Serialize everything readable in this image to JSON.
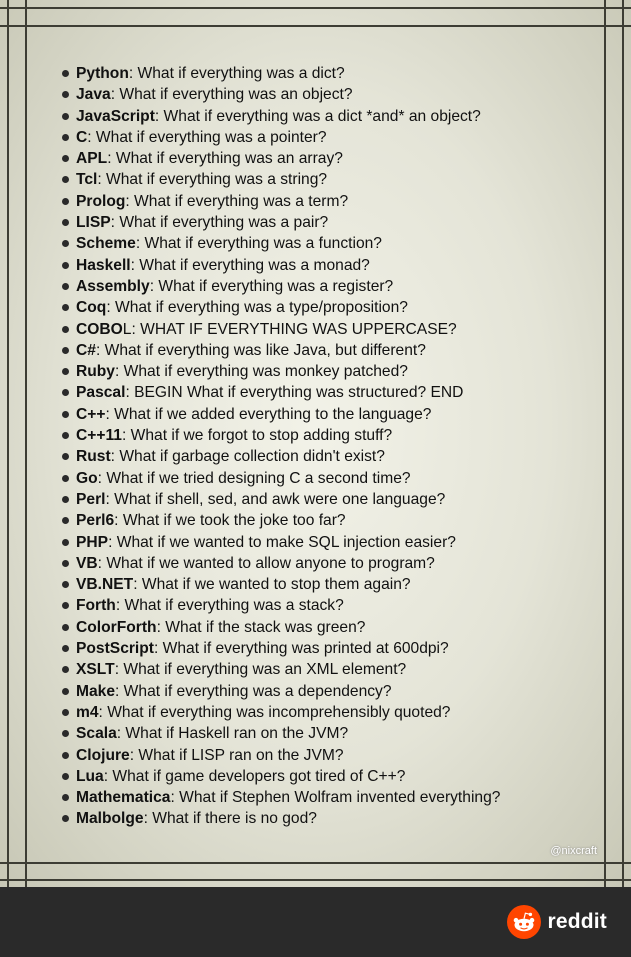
{
  "items": [
    {
      "lang": "Python",
      "text": ": What if everything was a dict?"
    },
    {
      "lang": "Java",
      "text": ": What if everything was an object?"
    },
    {
      "lang": "JavaScript",
      "text": ": What if everything was a dict *and* an object?"
    },
    {
      "lang": "C",
      "text": ": What if everything was a pointer?"
    },
    {
      "lang": "APL",
      "text": ": What if everything was an array?"
    },
    {
      "lang": "Tcl",
      "text": ": What if everything was a string?"
    },
    {
      "lang": "Prolog",
      "text": ": What if everything was a term?"
    },
    {
      "lang": "LISP",
      "text": ": What if everything was a pair?"
    },
    {
      "lang": "Scheme",
      "text": ": What if everything was a function?"
    },
    {
      "lang": "Haskell",
      "text": ": What if everything was a monad?"
    },
    {
      "lang": "Assembly",
      "text": ": What if everything was a register?"
    },
    {
      "lang": "Coq",
      "text": ": What if everything was a type/proposition?"
    },
    {
      "lang": "COBO",
      "text": "L: WHAT IF EVERYTHING WAS UPPERCASE?"
    },
    {
      "lang": "C#",
      "text": ": What if everything was like Java, but different?"
    },
    {
      "lang": "Ruby",
      "text": ": What if everything was monkey patched?"
    },
    {
      "lang": "Pascal",
      "text": ": BEGIN What if everything was structured? END"
    },
    {
      "lang": "C++",
      "text": ": What if we added everything to the language?"
    },
    {
      "lang": "C++11",
      "text": ": What if we forgot to stop adding stuff?"
    },
    {
      "lang": "Rust",
      "text": ": What if garbage collection didn't exist?"
    },
    {
      "lang": "Go",
      "text": ": What if we tried designing C a second time?"
    },
    {
      "lang": "Perl",
      "text": ": What if shell, sed, and awk were one language?"
    },
    {
      "lang": "Perl6",
      "text": ": What if we took the joke too far?"
    },
    {
      "lang": "PHP",
      "text": ": What if we wanted to make SQL injection easier?"
    },
    {
      "lang": "VB",
      "text": ": What if we wanted to allow anyone to program?"
    },
    {
      "lang": "VB.NET",
      "text": ": What if we wanted to stop them again?"
    },
    {
      "lang": "Forth",
      "text": ": What if everything was a stack?"
    },
    {
      "lang": "ColorForth",
      "text": ": What if the stack was green?"
    },
    {
      "lang": "PostScript",
      "text": ": What if everything was printed at 600dpi?"
    },
    {
      "lang": "XSLT",
      "text": ": What if everything was an XML element?"
    },
    {
      "lang": "Make",
      "text": ": What if everything was a dependency?"
    },
    {
      "lang": "m4",
      "text": ": What if everything was incomprehensibly quoted?"
    },
    {
      "lang": "Scala",
      "text": ": What if Haskell ran on the JVM?"
    },
    {
      "lang": "Clojure",
      "text": ": What if LISP ran on the JVM?"
    },
    {
      "lang": "Lua",
      "text": ": What if game developers got tired of C++?"
    },
    {
      "lang": "Mathematica",
      "text": ": What if Stephen Wolfram invented everything?"
    },
    {
      "lang": "Malbolge",
      "text": ": What if there is no god?"
    }
  ],
  "credit": "@nixcraft",
  "footer": {
    "brand": "reddit",
    "brand_color": "#FF4500"
  }
}
